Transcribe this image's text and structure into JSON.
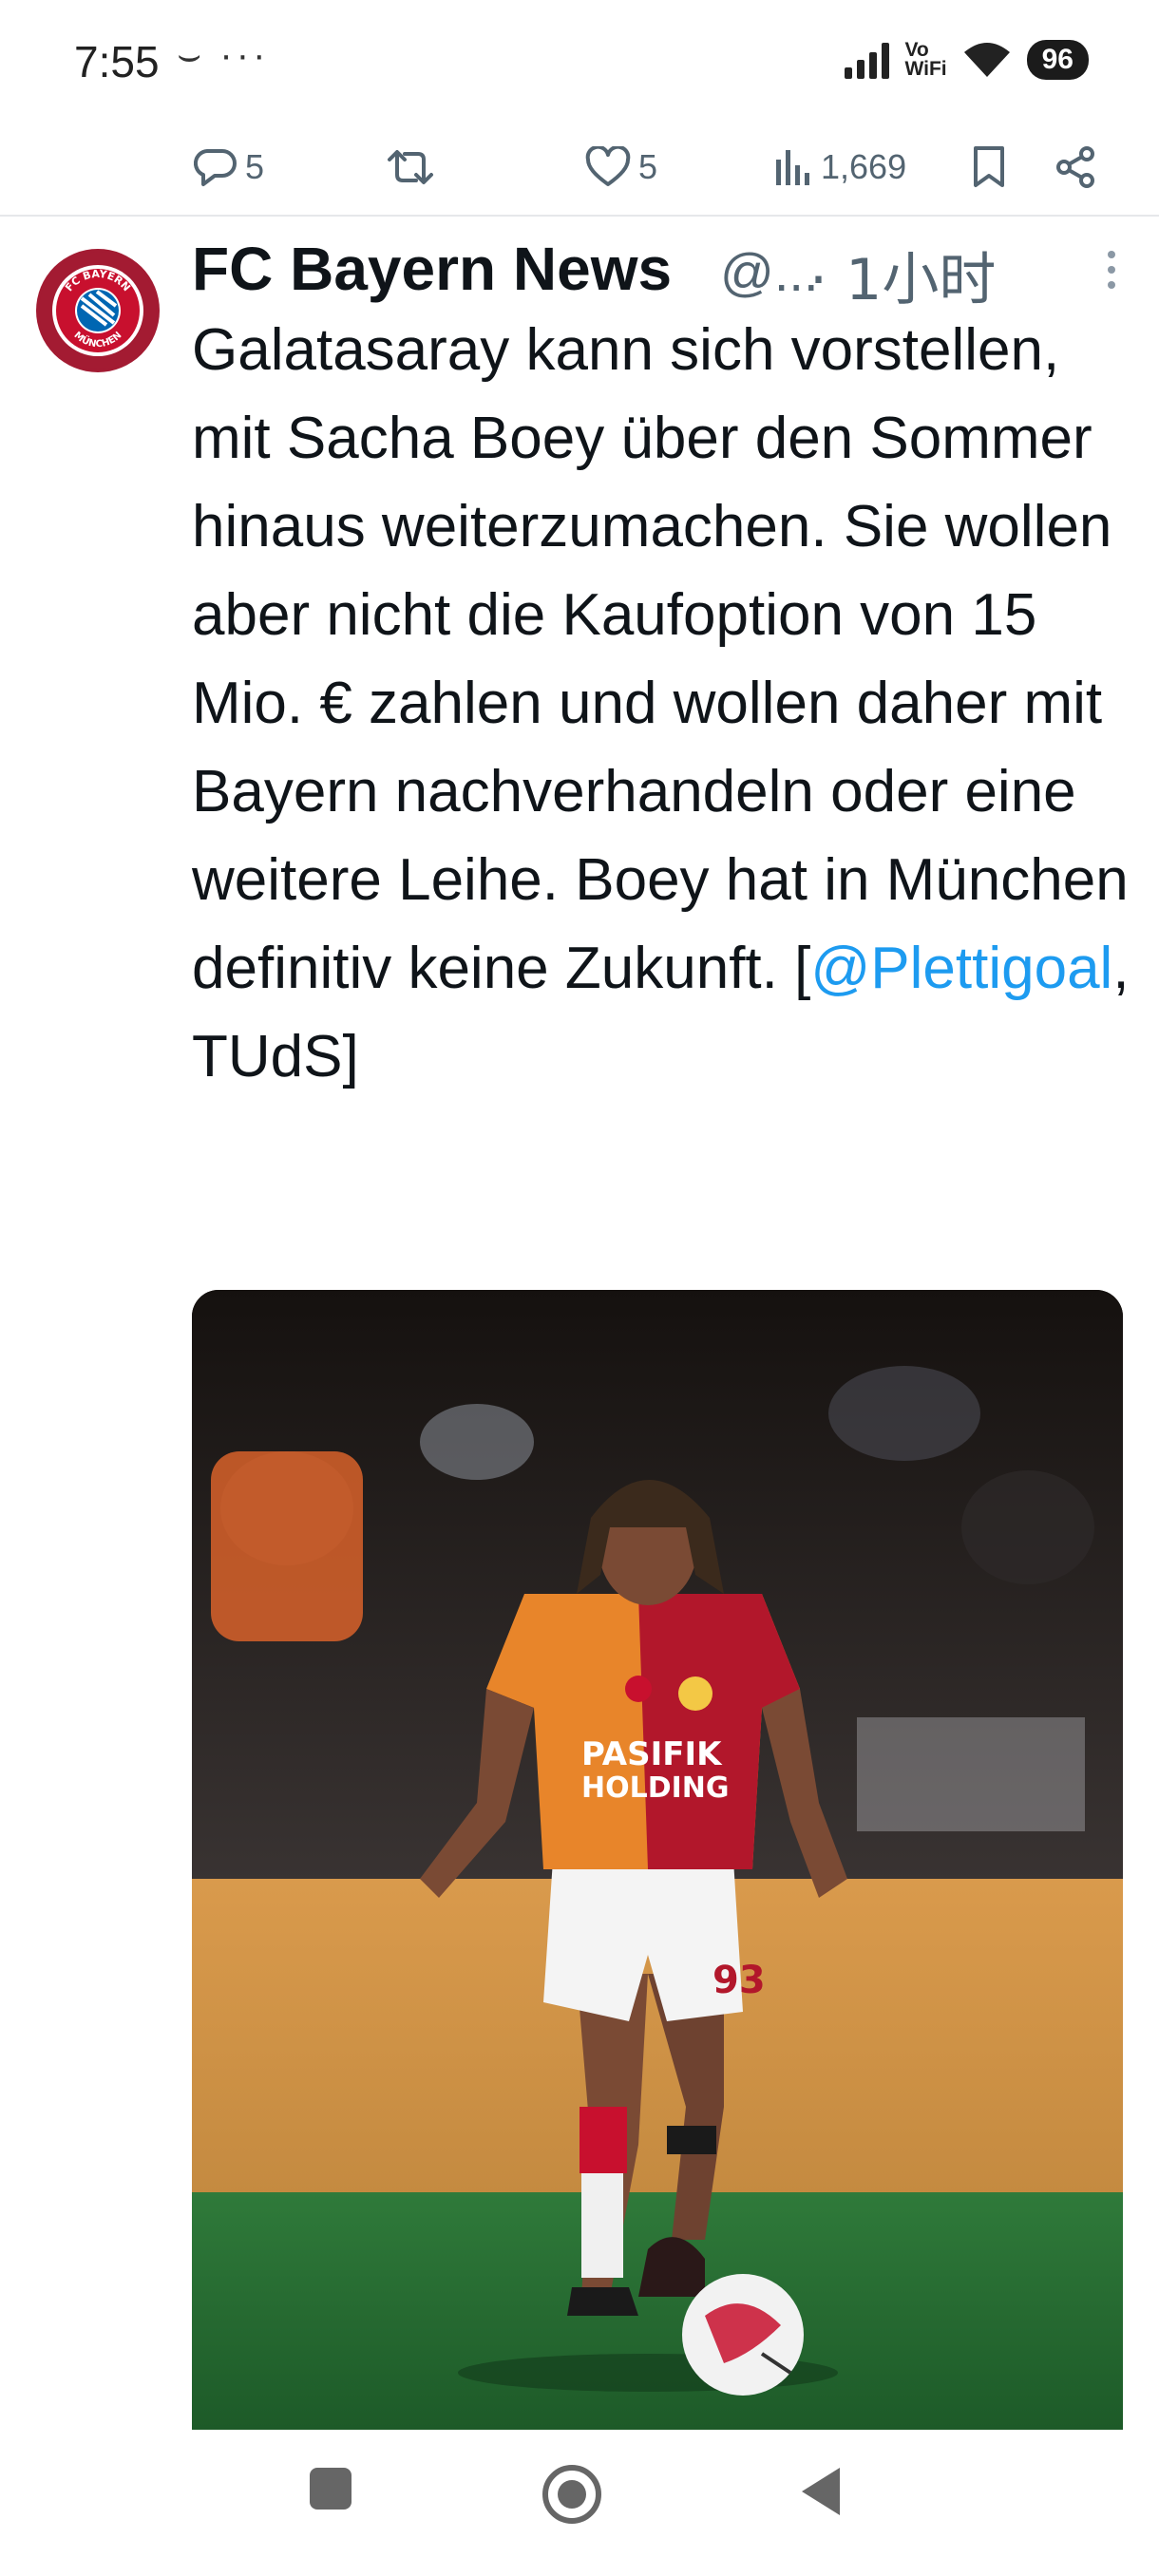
{
  "status_bar": {
    "time": "7:55",
    "extra": "⌣ ···",
    "network_label_top": "Vo",
    "network_label_bottom": "WiFi",
    "battery": "96"
  },
  "actions": {
    "replies": "5",
    "likes": "5",
    "views": "1,669"
  },
  "tweet": {
    "author_name": "FC Bayern News",
    "author_handle": "@...",
    "time": "· 1小时",
    "text_before_mention": "Galatasaray kann sich vorstellen, mit Sacha Boey über den Sommer hinaus weiterzumachen. Sie wollen aber nicht die Kaufoption von 15 Mio. € zahlen und wollen daher mit Bayern nachverhandeln oder eine weitere Leihe. Boey hat in München definitiv keine Zukunft. [",
    "mention": "@Plettigoal",
    "text_after_mention": ", TUdS]",
    "avatar_badge_top": "FC BAYERN",
    "avatar_badge_bottom": "MÜNCHEN",
    "media": {
      "jersey_sponsor_line1": "PASIFIK",
      "jersey_sponsor_line2": "HOLDING",
      "shirt_number": "93"
    }
  },
  "colors": {
    "accent": "#1d9bf0",
    "secondary_text": "#536471",
    "bayern_red": "#a31b32"
  }
}
